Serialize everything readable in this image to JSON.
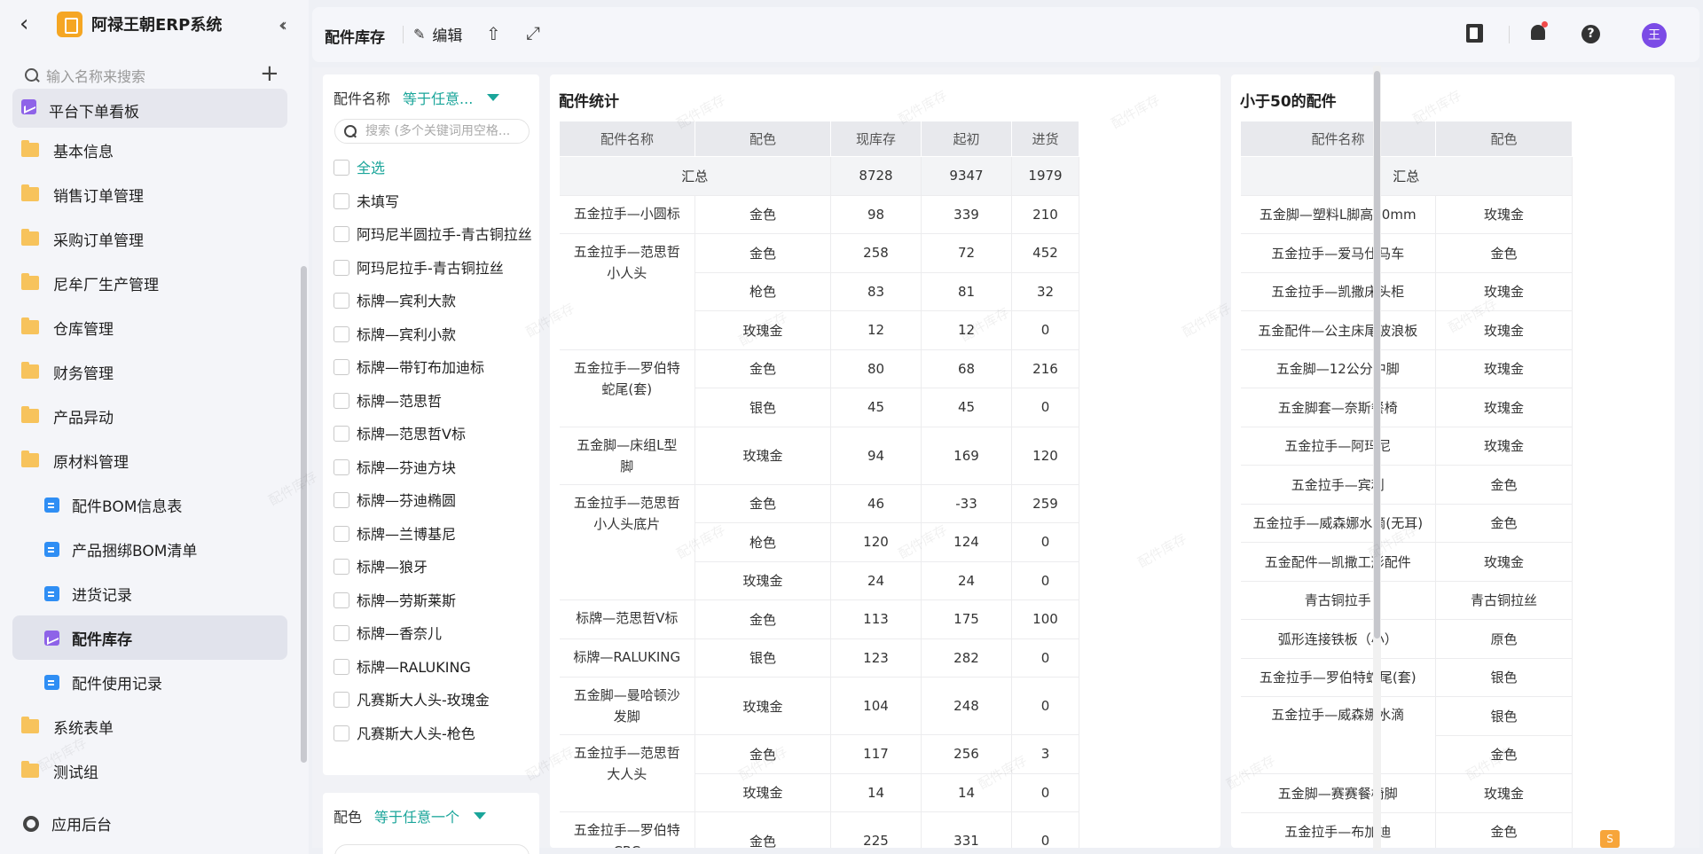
{
  "app": {
    "title": "阿禄王朝ERP系统"
  },
  "sidebar": {
    "search_placeholder": "输入名称来搜索",
    "partial_item": "平台下单看板",
    "items": [
      {
        "label": "基本信息",
        "type": "folder"
      },
      {
        "label": "销售订单管理",
        "type": "folder"
      },
      {
        "label": "采购订单管理",
        "type": "folder"
      },
      {
        "label": "尼牟厂生产管理",
        "type": "folder"
      },
      {
        "label": "仓库管理",
        "type": "folder"
      },
      {
        "label": "财务管理",
        "type": "folder"
      },
      {
        "label": "产品异动",
        "type": "folder"
      },
      {
        "label": "原材料管理",
        "type": "folder"
      },
      {
        "label": "配件BOM信息表",
        "type": "doc"
      },
      {
        "label": "产品捆绑BOM清单",
        "type": "doc"
      },
      {
        "label": "进货记录",
        "type": "doc"
      },
      {
        "label": "配件库存",
        "type": "chart",
        "active": true
      },
      {
        "label": "配件使用记录",
        "type": "doc"
      },
      {
        "label": "系统表单",
        "type": "folder"
      },
      {
        "label": "测试组",
        "type": "folder"
      }
    ],
    "footer_label": "应用后台"
  },
  "topbar": {
    "title": "配件库存",
    "edit_label": "编辑",
    "avatar_text": "王"
  },
  "filter": {
    "label": "配件名称",
    "operator": "等于任意...",
    "search_placeholder": "搜索 (多个关键词用空格...",
    "options": [
      {
        "label": "全选",
        "highlight": true
      },
      {
        "label": "未填写"
      },
      {
        "label": "阿玛尼半圆拉手-青古铜拉丝"
      },
      {
        "label": "阿玛尼拉手-青古铜拉丝"
      },
      {
        "label": "标牌—宾利大款"
      },
      {
        "label": "标牌—宾利小款"
      },
      {
        "label": "标牌—带钉布加迪标"
      },
      {
        "label": "标牌—范思哲"
      },
      {
        "label": "标牌—范思哲V标"
      },
      {
        "label": "标牌—芬迪方块"
      },
      {
        "label": "标牌—芬迪椭圆"
      },
      {
        "label": "标牌—兰博基尼"
      },
      {
        "label": "标牌—狼牙"
      },
      {
        "label": "标牌—劳斯莱斯"
      },
      {
        "label": "标牌—香奈儿"
      },
      {
        "label": "标牌—RALUKING"
      },
      {
        "label": "凡赛斯大人头-玫瑰金"
      },
      {
        "label": "凡赛斯大人头-枪色"
      }
    ],
    "second_label": "配色",
    "second_operator": "等于任意一个"
  },
  "stats": {
    "title": "配件统计",
    "columns": [
      "配件名称",
      "配色",
      "现库存",
      "起初",
      "进货"
    ],
    "summary": {
      "label": "汇总",
      "stock": "8728",
      "initial": "9347",
      "purchase": "1979"
    },
    "rows": [
      {
        "name": "五金拉手—小圆标",
        "span": 1,
        "color": "金色",
        "stock": "98",
        "initial": "339",
        "purchase": "210"
      },
      {
        "name": "五金拉手—范思哲小人头",
        "span": 3,
        "color": "金色",
        "stock": "258",
        "initial": "72",
        "purchase": "452"
      },
      {
        "color": "枪色",
        "stock": "83",
        "initial": "81",
        "purchase": "32"
      },
      {
        "color": "玫瑰金",
        "stock": "12",
        "initial": "12",
        "purchase": "0"
      },
      {
        "name": "五金拉手—罗伯特蛇尾(套)",
        "span": 2,
        "color": "金色",
        "stock": "80",
        "initial": "68",
        "purchase": "216"
      },
      {
        "color": "银色",
        "stock": "45",
        "initial": "45",
        "purchase": "0"
      },
      {
        "name": "五金脚—床组L型脚",
        "span": 1,
        "color": "玫瑰金",
        "stock": "94",
        "initial": "169",
        "purchase": "120"
      },
      {
        "name": "五金拉手—范思哲小人头底片",
        "span": 3,
        "color": "金色",
        "stock": "46",
        "initial": "-33",
        "purchase": "259"
      },
      {
        "color": "枪色",
        "stock": "120",
        "initial": "124",
        "purchase": "0"
      },
      {
        "color": "玫瑰金",
        "stock": "24",
        "initial": "24",
        "purchase": "0"
      },
      {
        "name": "标牌—范思哲V标",
        "span": 1,
        "color": "金色",
        "stock": "113",
        "initial": "175",
        "purchase": "100"
      },
      {
        "name": "标牌—RALUKING",
        "span": 1,
        "color": "银色",
        "stock": "123",
        "initial": "282",
        "purchase": "0"
      },
      {
        "name": "五金脚—曼哈顿沙发脚",
        "span": 1,
        "tall": true,
        "color": "玫瑰金",
        "stock": "104",
        "initial": "248",
        "purchase": "0"
      },
      {
        "name": "五金拉手—范思哲大人头",
        "span": 2,
        "color": "金色",
        "stock": "117",
        "initial": "256",
        "purchase": "3"
      },
      {
        "color": "玫瑰金",
        "stock": "14",
        "initial": "14",
        "purchase": "0"
      },
      {
        "name": "五金拉手—罗伯特CRC",
        "span": 1,
        "color": "金色",
        "stock": "225",
        "initial": "331",
        "purchase": "0"
      }
    ]
  },
  "small": {
    "title": "小于50的配件",
    "columns": [
      "配件名称",
      "配色"
    ],
    "summary_label": "汇总",
    "rows": [
      {
        "name": "五金脚—塑料L脚高50mm",
        "span": 1,
        "color": "玫瑰金"
      },
      {
        "name": "五金拉手—爱马仕马车",
        "span": 1,
        "color": "金色"
      },
      {
        "name": "五金拉手—凯撒床头柜",
        "span": 1,
        "color": "玫瑰金"
      },
      {
        "name": "五金配件—公主床尾波浪板",
        "span": 1,
        "color": "玫瑰金"
      },
      {
        "name": "五金脚—12公分中脚",
        "span": 1,
        "color": "玫瑰金"
      },
      {
        "name": "五金脚套—奈斯餐椅",
        "span": 1,
        "color": "玫瑰金"
      },
      {
        "name": "五金拉手—阿玛尼",
        "span": 1,
        "color": "玫瑰金"
      },
      {
        "name": "五金拉手—宾利",
        "span": 1,
        "color": "金色"
      },
      {
        "name": "五金拉手—威森娜水滴(无耳)",
        "span": 1,
        "color": "金色"
      },
      {
        "name": "五金配件—凯撒工形配件",
        "span": 1,
        "color": "玫瑰金"
      },
      {
        "name": "青古铜拉手",
        "span": 1,
        "color": "青古铜拉丝"
      },
      {
        "name": "弧形连接铁板（小）",
        "span": 1,
        "color": "原色"
      },
      {
        "name": "五金拉手—罗伯特蛇尾(套)",
        "span": 1,
        "color": "银色"
      },
      {
        "name": "五金拉手—威森娜水滴",
        "span": 2,
        "color": "银色"
      },
      {
        "color": "金色"
      },
      {
        "name": "五金脚—赛赛餐椅脚",
        "span": 1,
        "color": "玫瑰金"
      },
      {
        "name": "五金拉手—布加迪",
        "span": 1,
        "color": "金色"
      }
    ]
  },
  "colors": {
    "accent": "#1aa59a",
    "avatar": "#7b4be6",
    "active_icon": "#8e63e8",
    "doc_icon": "#2f8ef4",
    "folder": "#f7c35c"
  }
}
